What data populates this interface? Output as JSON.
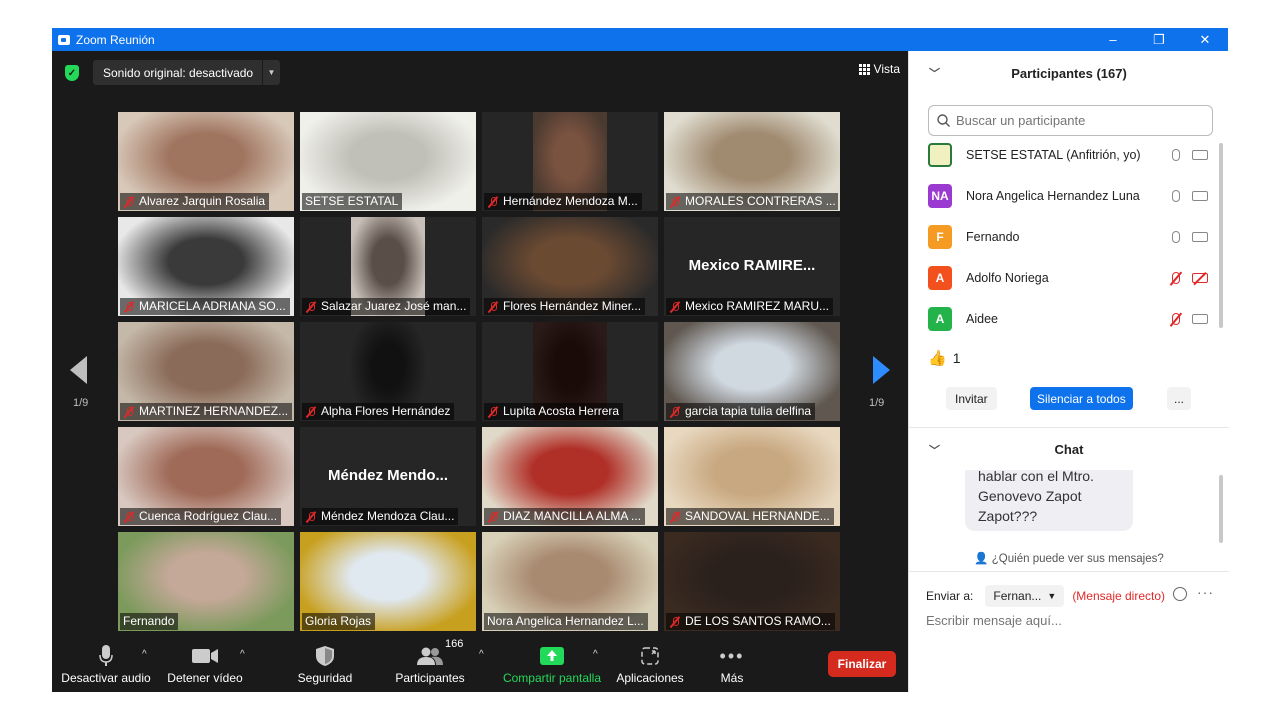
{
  "window": {
    "title": "Zoom Reunión",
    "minimize": "–",
    "maximize": "❐",
    "close": "✕"
  },
  "topbar": {
    "audio_label": "Sonido original: desactivado",
    "view_label": "Vista"
  },
  "gallery": {
    "page_left": "1/9",
    "page_right": "1/9",
    "tiles": [
      {
        "name": "Alvarez Jarquin Rosalia",
        "muted": true,
        "video": true
      },
      {
        "name": "SETSE ESTATAL",
        "muted": false,
        "video": true
      },
      {
        "name": "Hernández Mendoza M...",
        "muted": true,
        "video": true
      },
      {
        "name": "MORALES CONTRERAS ...",
        "muted": true,
        "video": true
      },
      {
        "name": "MARICELA ADRIANA SO...",
        "muted": true,
        "video": true
      },
      {
        "name": "Salazar Juarez José man...",
        "muted": true,
        "video": true
      },
      {
        "name": "Flores Hernández Miner...",
        "muted": true,
        "video": true
      },
      {
        "name": "Mexico RAMIREZ MARU...",
        "muted": true,
        "video": false,
        "big": "Mexico  RAMIRE..."
      },
      {
        "name": "MARTINEZ HERNANDEZ...",
        "muted": true,
        "video": true
      },
      {
        "name": "Alpha Flores Hernández",
        "muted": true,
        "video": true
      },
      {
        "name": "Lupita Acosta Herrera",
        "muted": true,
        "video": true
      },
      {
        "name": "garcia  tapia tulia delfina",
        "muted": true,
        "video": true
      },
      {
        "name": "Cuenca Rodríguez Clau...",
        "muted": true,
        "video": true
      },
      {
        "name": "Méndez Mendoza Clau...",
        "muted": true,
        "video": false,
        "big": "Méndez  Mendo..."
      },
      {
        "name": "DIAZ MANCILLA ALMA ...",
        "muted": true,
        "video": true
      },
      {
        "name": "SANDOVAL HERNANDE...",
        "muted": true,
        "video": true
      },
      {
        "name": "Fernando",
        "muted": false,
        "video": true
      },
      {
        "name": "Gloria Rojas",
        "muted": false,
        "video": true
      },
      {
        "name": "Nora Angelica Hernandez L...",
        "muted": false,
        "video": true
      },
      {
        "name": "DE LOS SANTOS RAMO...",
        "muted": true,
        "video": true
      }
    ]
  },
  "toolbar": {
    "audio": "Desactivar audio",
    "video": "Detener vídeo",
    "security": "Seguridad",
    "participants": "Participantes",
    "participants_count": "166",
    "share": "Compartir pantalla",
    "apps": "Aplicaciones",
    "more": "Más",
    "end": "Finalizar"
  },
  "participants_panel": {
    "title": "Participantes (167)",
    "search_placeholder": "Buscar un participante",
    "list": [
      {
        "initials": "",
        "name": "SETSE ESTATAL (Anfitrión, yo)",
        "color": "#f0f0c0",
        "mic_off": false,
        "video_off": false
      },
      {
        "initials": "NA",
        "name": "Nora Angelica Hernandez Luna",
        "color": "#9b3ad0",
        "mic_off": false,
        "video_off": false
      },
      {
        "initials": "F",
        "name": "Fernando",
        "color": "#f59a23",
        "mic_off": false,
        "video_off": false
      },
      {
        "initials": "A",
        "name": "Adolfo Noriega",
        "color": "#f2501c",
        "mic_off": true,
        "video_off": true
      },
      {
        "initials": "A",
        "name": "Aidee",
        "color": "#23b34a",
        "mic_off": true,
        "video_off": false
      }
    ],
    "reaction_count": "1",
    "invite": "Invitar",
    "mute_all": "Silenciar a todos",
    "more": "..."
  },
  "chat": {
    "title": "Chat",
    "message": "hablar con el Mtro. Genovevo Zapot Zapot???",
    "who_can_see": "¿Quién puede ver sus mensajes?",
    "send_to_label": "Enviar a:",
    "send_to_value": "Fernan...",
    "direct": "(Mensaje directo)",
    "input_placeholder": "Escribir mensaje aquí..."
  }
}
